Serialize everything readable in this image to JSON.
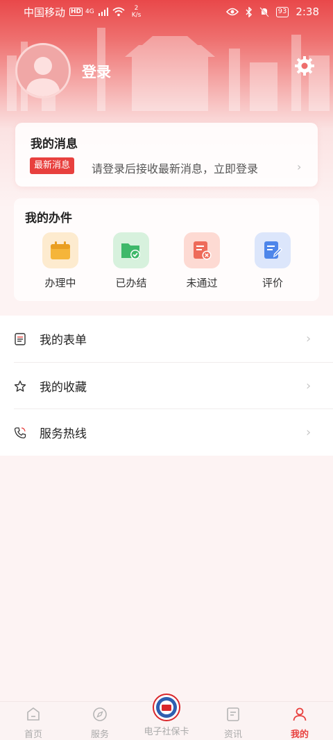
{
  "status_bar": {
    "carrier": "中国移动",
    "hd": "HD",
    "network_type": "4G",
    "speed_value": "2",
    "speed_unit": "K/s",
    "battery": "93",
    "time": "2:38"
  },
  "profile": {
    "login_label": "登录"
  },
  "messages": {
    "title": "我的消息",
    "badge": "最新消息",
    "text": "请登录后接收最新消息，立即登录"
  },
  "affairs": {
    "title": "我的办件",
    "items": [
      {
        "label": "办理中",
        "icon": "calendar-icon",
        "color": "#f5b53a"
      },
      {
        "label": "已办结",
        "icon": "folder-check-icon",
        "color": "#3fb86a"
      },
      {
        "label": "未通过",
        "icon": "doc-reject-icon",
        "color": "#ee6b5a"
      },
      {
        "label": "评价",
        "icon": "doc-edit-icon",
        "color": "#4e86ea"
      }
    ]
  },
  "menu": {
    "items": [
      {
        "label": "我的表单",
        "icon": "form-icon"
      },
      {
        "label": "我的收藏",
        "icon": "star-icon"
      },
      {
        "label": "服务热线",
        "icon": "phone-icon"
      }
    ]
  },
  "bottom_nav": {
    "items": [
      {
        "label": "首页",
        "icon": "home-icon"
      },
      {
        "label": "服务",
        "icon": "compass-icon"
      },
      {
        "label": "电子社保卡",
        "icon": "social-security-card-icon"
      },
      {
        "label": "资讯",
        "icon": "news-icon"
      },
      {
        "label": "我的",
        "icon": "user-icon",
        "active": true
      }
    ]
  },
  "colors": {
    "brand_red": "#e8403e",
    "background": "#fdf3f3"
  }
}
